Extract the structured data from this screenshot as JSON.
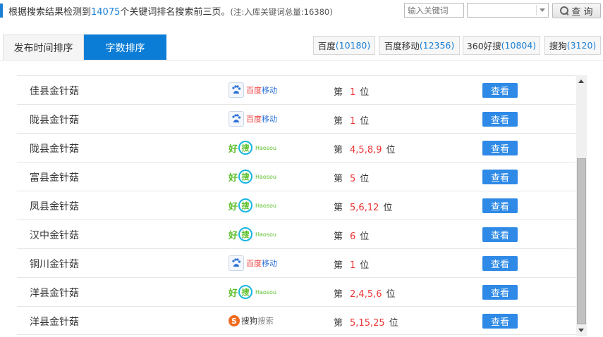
{
  "header": {
    "summary_prefix": "根据搜索结果检测到",
    "keyword_count": "14075",
    "summary_suffix": "个关键词排名搜索前三页。",
    "note": "(注:入库关键词总量:16380)",
    "search_placeholder": "输入关键词",
    "query_button": "查 询"
  },
  "sort_tabs": [
    {
      "label": "发布时间排序",
      "active": false
    },
    {
      "label": "字数排序",
      "active": true
    }
  ],
  "engines": [
    {
      "name": "百度",
      "count": "(10180)"
    },
    {
      "name": "百度移动",
      "count": "(12356)"
    },
    {
      "name": "360好搜",
      "count": "(10804)"
    },
    {
      "name": "搜狗",
      "count": "(3120)"
    }
  ],
  "rows": [
    {
      "keyword": "佳县金针菇",
      "engine": "baidu-mobile",
      "rank_prefix": "第",
      "rank": "1",
      "rank_suffix": "位",
      "action": "查看"
    },
    {
      "keyword": "陇县金针菇",
      "engine": "baidu-mobile",
      "rank_prefix": "第",
      "rank": "1",
      "rank_suffix": "位",
      "action": "查看"
    },
    {
      "keyword": "陇县金针菇",
      "engine": "haosou",
      "rank_prefix": "第",
      "rank": "4,5,8,9",
      "rank_suffix": "位",
      "action": "查看"
    },
    {
      "keyword": "富县金针菇",
      "engine": "haosou",
      "rank_prefix": "第",
      "rank": "5",
      "rank_suffix": "位",
      "action": "查看"
    },
    {
      "keyword": "凤县金针菇",
      "engine": "haosou",
      "rank_prefix": "第",
      "rank": "5,6,12",
      "rank_suffix": "位",
      "action": "查看"
    },
    {
      "keyword": "汉中金针菇",
      "engine": "haosou",
      "rank_prefix": "第",
      "rank": "6",
      "rank_suffix": "位",
      "action": "查看"
    },
    {
      "keyword": "铜川金针菇",
      "engine": "baidu-mobile",
      "rank_prefix": "第",
      "rank": "1",
      "rank_suffix": "位",
      "action": "查看"
    },
    {
      "keyword": "洋县金针菇",
      "engine": "haosou",
      "rank_prefix": "第",
      "rank": "2,4,5,6",
      "rank_suffix": "位",
      "action": "查看"
    },
    {
      "keyword": "洋县金针菇",
      "engine": "sogou",
      "rank_prefix": "第",
      "rank": "5,15,25",
      "rank_suffix": "位",
      "action": "查看"
    }
  ],
  "logos": {
    "baidu-mobile": {
      "text1": "百度",
      "text2": "移动"
    },
    "haosou": {
      "text1": "好",
      "text2": "搜",
      "en": "Haosou"
    },
    "sogou": {
      "mark": "S",
      "text1": "搜狗",
      "text2": "搜索"
    }
  },
  "colors": {
    "accent": "#1a7fd4",
    "active_tab": "#0b7dd6",
    "rank_value": "#e33333",
    "view_button": "#2e8ae6"
  }
}
